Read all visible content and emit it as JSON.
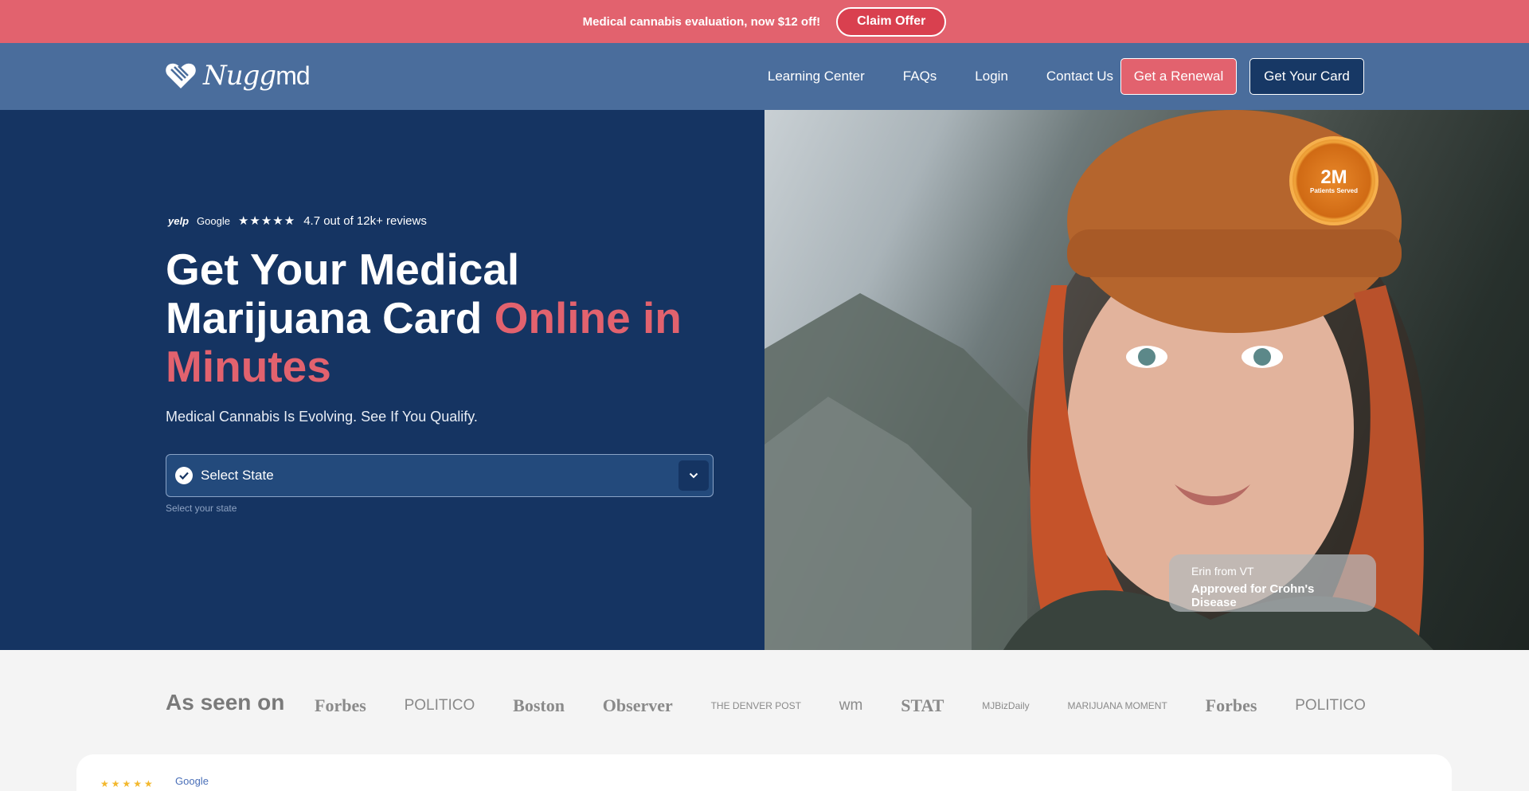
{
  "promo": {
    "text": "Medical cannabis evaluation, now $12 off!",
    "button": "Claim Offer"
  },
  "header": {
    "logo_main": "Nugg",
    "logo_suffix": "md",
    "nav": [
      "Learning Center",
      "FAQs",
      "Login",
      "Contact Us"
    ],
    "renew_button": "Get a Renewal",
    "card_button": "Get Your Card"
  },
  "hero": {
    "review_sources": [
      "yelp",
      "Google"
    ],
    "stars": "★★★★★",
    "rating_text": "4.7 out of 12k+ reviews",
    "headline_line1": "Get Your Medical",
    "headline_line2a": "Marijuana Card ",
    "headline_accent": "Online in Minutes",
    "subline": "Medical Cannabis Is Evolving. See If You Qualify.",
    "select_label": "Select State",
    "select_help": "Select your state"
  },
  "badge": {
    "big": "2M",
    "small": "Patients Served"
  },
  "testimonial": {
    "name": "Erin from VT",
    "condition": "Approved for Crohn's Disease"
  },
  "seen_on": {
    "title": "As seen on",
    "logos": [
      "Forbes",
      "POLITICO",
      "Boston",
      "Observer",
      "THE DENVER POST",
      "wm",
      "STAT",
      "MJBizDaily",
      "MARIJUANA MOMENT",
      "Forbes",
      "POLITICO"
    ]
  },
  "bottom": {
    "stars": "★★★★★",
    "source": "Google"
  },
  "colors": {
    "promo": "#e2626e",
    "header": "#4a6d9c",
    "hero": "#153462",
    "accent": "#e2626e"
  }
}
